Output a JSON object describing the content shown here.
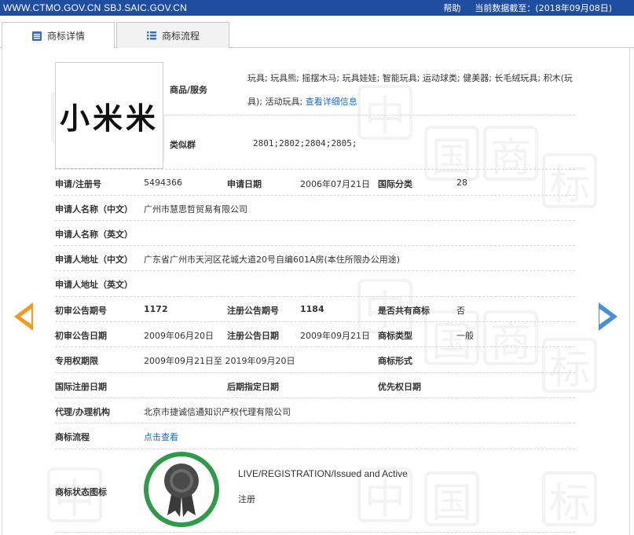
{
  "topbar": {
    "site": "WWW.CTMO.GOV.CN SBJ.SAIC.GOV.CN",
    "help": "帮助",
    "data_date": "当前数据截至：(2018年09月08日)"
  },
  "tabs": [
    {
      "label": "商标详情"
    },
    {
      "label": "商标流程"
    }
  ],
  "trademark": {
    "image_text": "小米米"
  },
  "goods": {
    "label": "商品/服务",
    "line1": "玩具; 玩具熊; 摇摆木马; 玩具娃娃; 智能玩具; 运动球类; 健美器; 长毛绒玩具; 积木(玩",
    "line2": "具); 活动玩具;",
    "detail_link": "查看详细信息"
  },
  "similar": {
    "label": "类似群",
    "value": "2801;2802;2804;2805;"
  },
  "fields": {
    "reg_no_label": "申请/注册号",
    "reg_no": "5494366",
    "app_date_label": "申请日期",
    "app_date": "2006年07月21日",
    "intl_class_label": "国际分类",
    "intl_class": "28",
    "applicant_cn_label": "申请人名称（中文）",
    "applicant_cn": "广州市慧思哲贸易有限公司",
    "applicant_en_label": "申请人名称（英文）",
    "address_cn_label": "申请人地址（中文）",
    "address_cn": "广东省广州市天河区花城大道20号自编601A房(本住所限办公用途)",
    "address_en_label": "申请人地址（英文）",
    "prelim_no_label": "初审公告期号",
    "prelim_no": "1172",
    "reg_notice_no_label": "注册公告期号",
    "reg_notice_no": "1184",
    "shared_label": "是否共有商标",
    "shared": "否",
    "prelim_date_label": "初审公告日期",
    "prelim_date": "2009年06月20日",
    "reg_notice_date_label": "注册公告日期",
    "reg_notice_date": "2009年09月21日",
    "tm_type_label": "商标类型",
    "tm_type": "一般",
    "exclusive_label": "专用权期限",
    "exclusive": "2009年09月21日至 2019年09月20日",
    "tm_form_label": "商标形式",
    "intl_reg_date_label": "国际注册日期",
    "later_designation_label": "后期指定日期",
    "priority_date_label": "优先权日期",
    "agent_label": "代理/办理机构",
    "agent": "北京市捷诚信通知识产权代理有限公司",
    "process_label": "商标流程",
    "process_link": "点击查看",
    "status_label": "商标状态图标",
    "status_en": "LIVE/REGISTRATION/Issued and Active",
    "status_cn": "注册"
  },
  "colors": {
    "topbar": "#1f4ea1",
    "link": "#1a6bc4",
    "left_arrow": "#f39a1e",
    "right_arrow": "#4a90d9",
    "badge_ring": "#2e9a4a"
  }
}
